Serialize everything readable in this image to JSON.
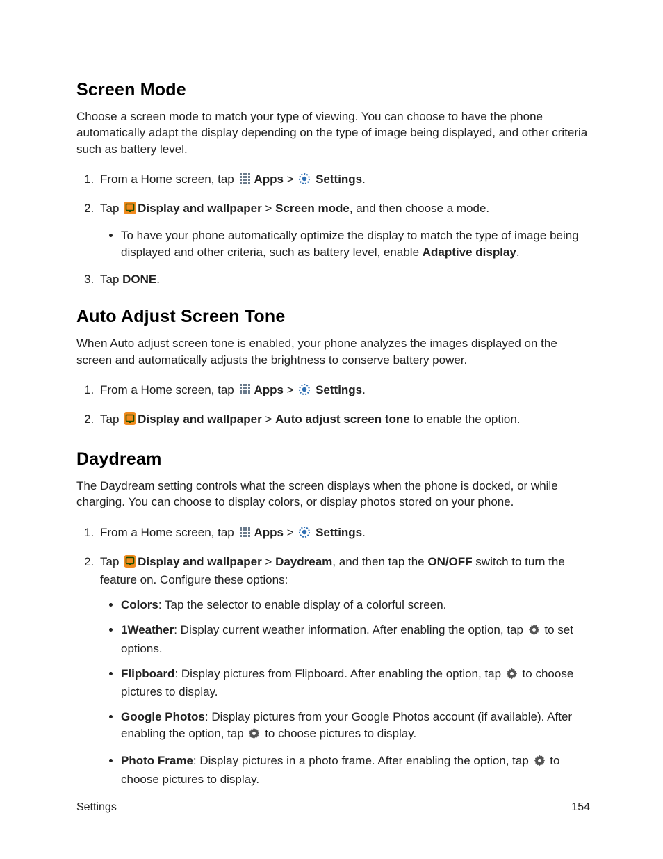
{
  "sections": [
    {
      "heading": "Screen Mode",
      "intro": "Choose a screen mode to match your type of viewing. You can choose to have the phone automatically adapt the display depending on the type of image being displayed, and other criteria such as battery level."
    },
    {
      "heading": "Auto Adjust Screen Tone",
      "intro": "When Auto adjust screen tone is enabled, your phone analyzes the images displayed on the screen and automatically adjusts the brightness to conserve battery power."
    },
    {
      "heading": "Daydream",
      "intro": "The Daydream setting controls what the screen displays when the phone is docked, or while charging. You can choose to display colors, or display photos stored on your phone."
    }
  ],
  "labels": {
    "from_home_tap": "From a Home screen, tap ",
    "apps": "Apps",
    "gt": " > ",
    "settings": "Settings",
    "period": ".",
    "tap": "Tap ",
    "display_wallpaper": "Display and wallpaper",
    "screen_mode": "Screen mode",
    "screen_mode_tail": ", and then choose a mode.",
    "adaptive_bullet_pre": "To have your phone automatically optimize the display to match the type of image being displayed and other criteria, such as battery level, enable ",
    "adaptive_display": "Adaptive display",
    "tap_done_pre": "Tap ",
    "done": "DONE",
    "auto_adjust": "Auto adjust screen tone",
    "auto_adjust_tail": " to enable the option.",
    "daydream": "Daydream",
    "daydream_tail1": ", and then tap the ",
    "onoff": "ON/OFF",
    "daydream_tail2": " switch to turn the feature on. Configure these options:",
    "colors": "Colors",
    "colors_tail": ": Tap the selector to enable display of a colorful screen.",
    "oneweather": "1Weather",
    "oneweather_mid": ": Display current weather information. After enabling the option, tap ",
    "oneweather_tail": " to set options.",
    "flipboard": "Flipboard",
    "flipboard_mid": ": Display pictures from Flipboard. After enabling the option, tap ",
    "flipboard_tail": " to choose pictures to display.",
    "gphotos": "Google Photos",
    "gphotos_mid": ": Display pictures from your Google Photos account (if available). After enabling the option, tap ",
    "gphotos_tail": " to choose pictures to display.",
    "pframe": "Photo Frame",
    "pframe_mid": ": Display pictures in a photo frame. After enabling the option, tap ",
    "pframe_tail": " to choose pictures to display."
  },
  "footer": {
    "left": "Settings",
    "right": "154"
  }
}
